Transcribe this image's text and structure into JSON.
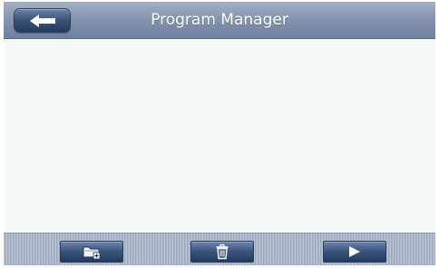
{
  "header": {
    "title": "Program Manager",
    "back_icon": "arrow-left-icon"
  },
  "content": {
    "items": []
  },
  "toolbar": {
    "buttons": [
      {
        "icon": "new-folder-icon"
      },
      {
        "icon": "trash-icon"
      },
      {
        "icon": "play-icon"
      }
    ]
  },
  "colors": {
    "titlebar": "#8395ae",
    "button": "#3b557e",
    "content_background": "#f4f9f6",
    "toolbar": "#a8b5c8",
    "title_text": "#ffffff"
  }
}
